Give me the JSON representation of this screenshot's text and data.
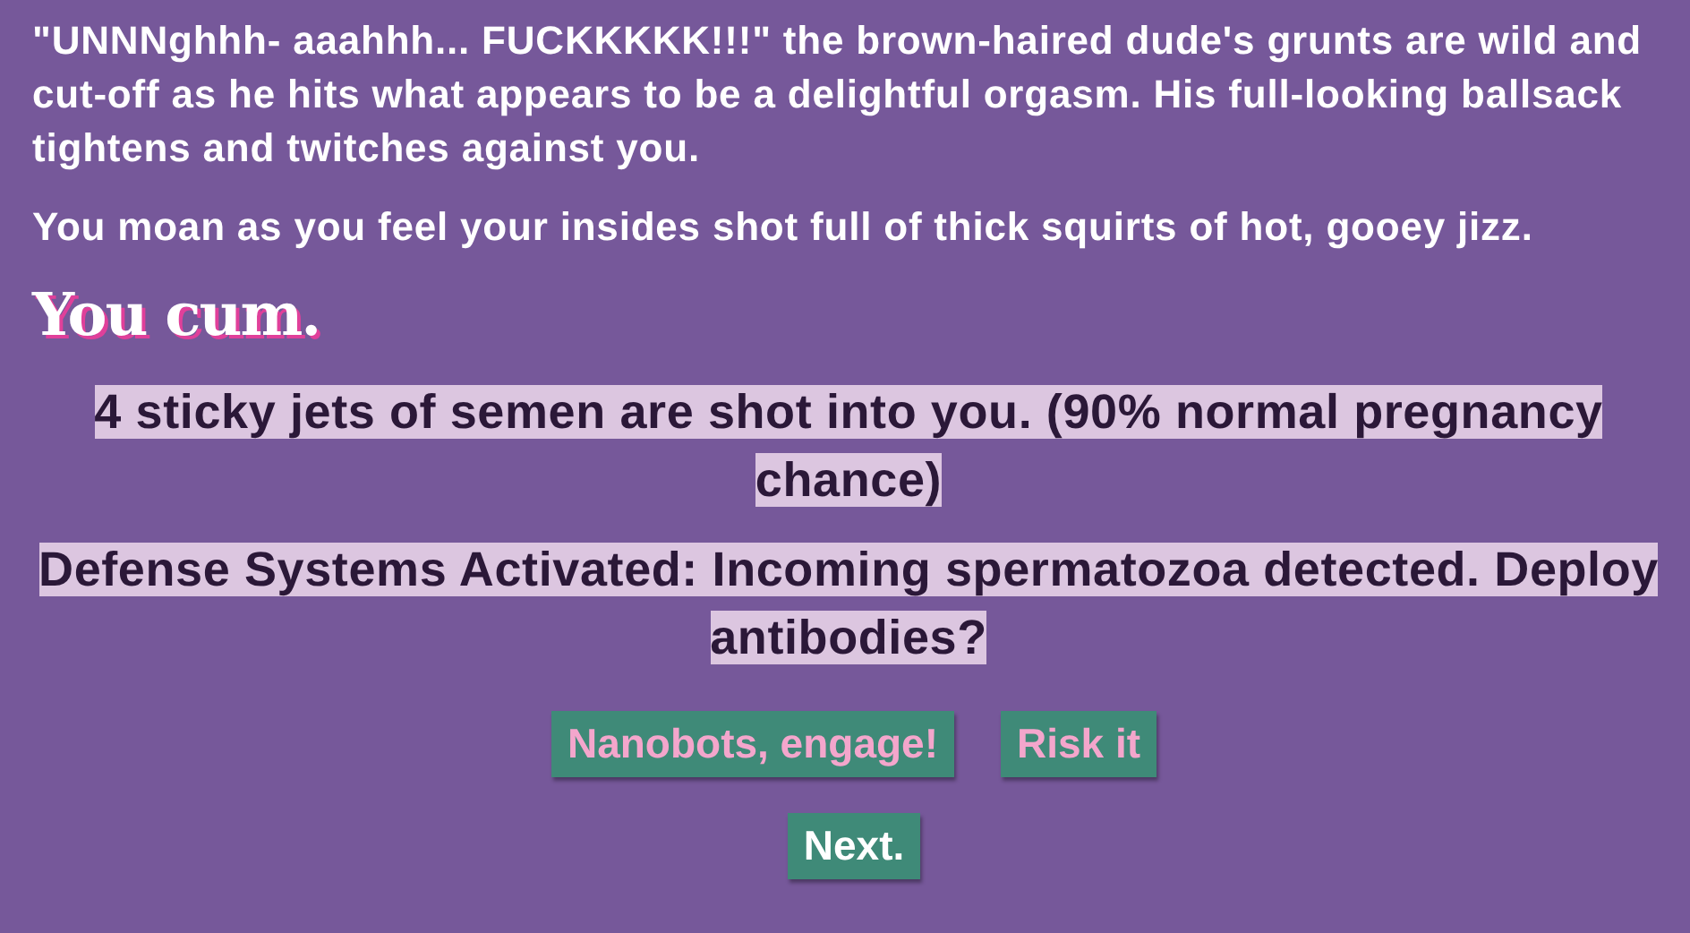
{
  "paragraphs": [
    "\"UNNNghhh- aaahhh... FUCKKKKK!!!\" the brown-haired dude's grunts are wild and cut-off as he hits what appears to be a delightful orgasm. His full-looking ballsack tightens and twitches against you.",
    "You moan as you feel your insides shot full of thick squirts of hot, gooey jizz."
  ],
  "headline": "You cum.",
  "notices": [
    "4 sticky jets of semen are shot into you. (90% normal pregnancy chance)",
    "Defense Systems Activated: Incoming spermatozoa detected. Deploy antibodies?"
  ],
  "choices": [
    {
      "label": "Nanobots, engage!",
      "kind": "choice"
    },
    {
      "label": "Risk it",
      "kind": "choice"
    }
  ],
  "next": {
    "label": "Next.",
    "kind": "continue"
  }
}
